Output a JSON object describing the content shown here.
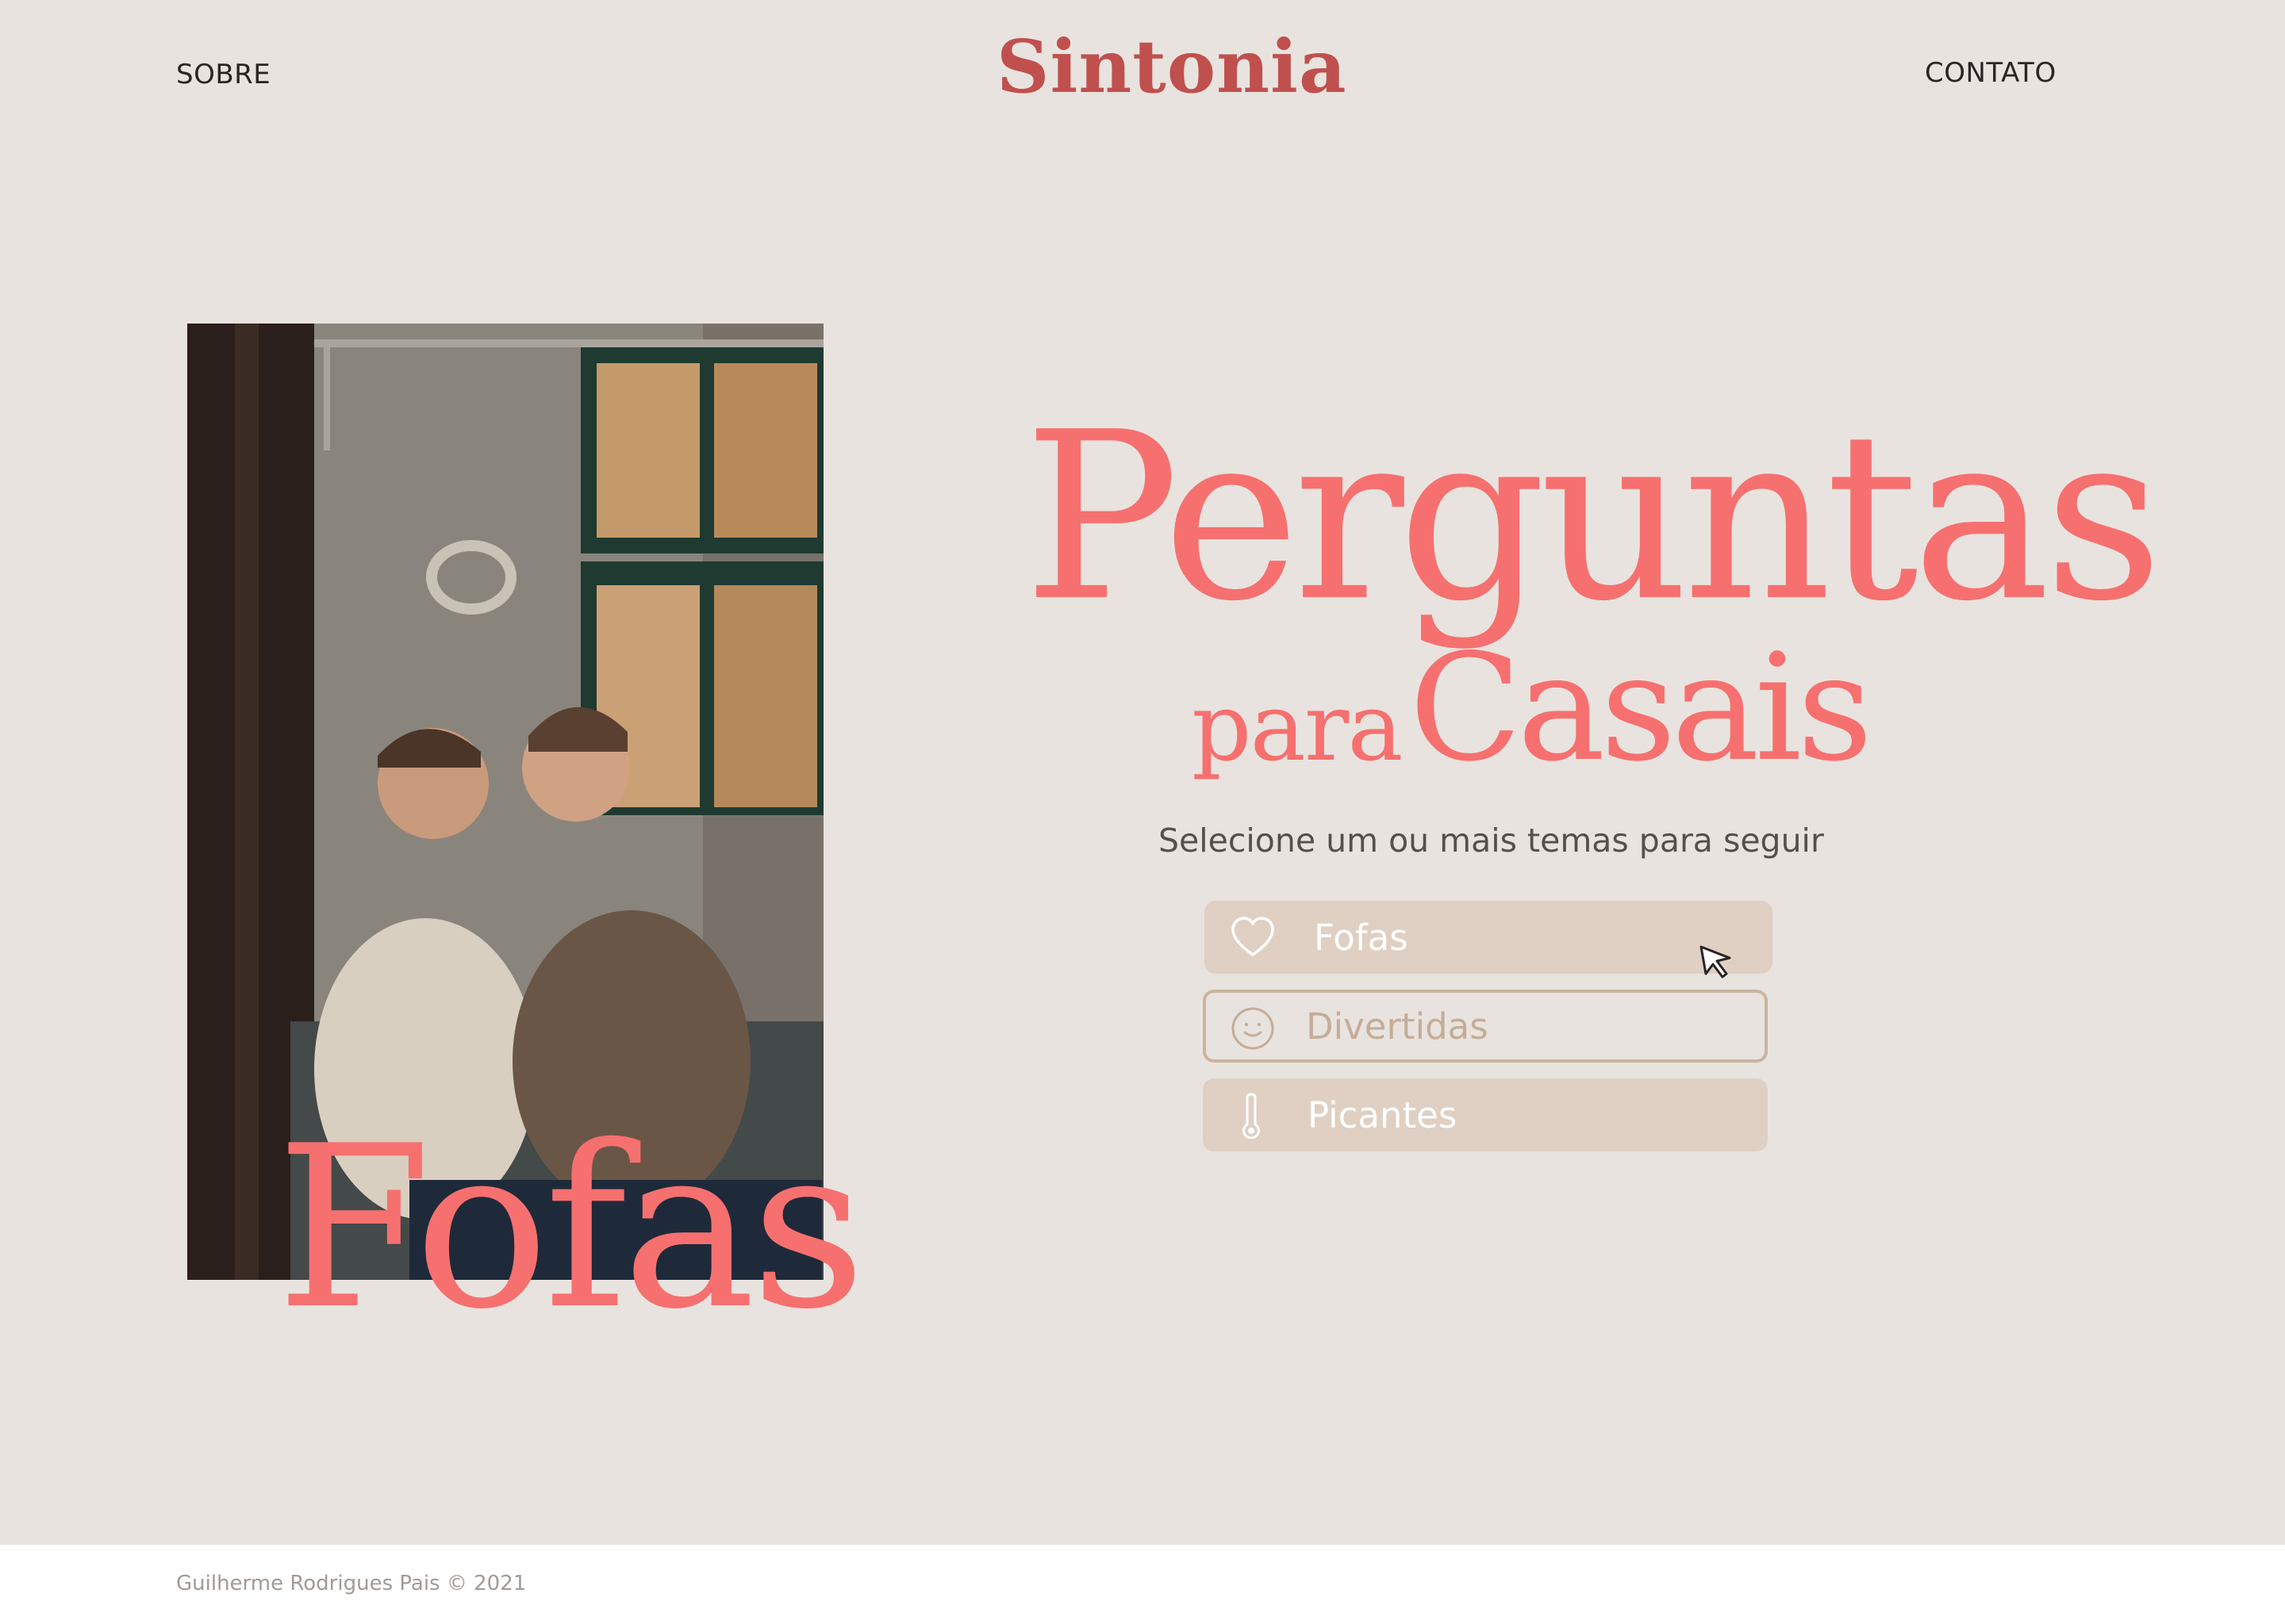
{
  "header": {
    "brand": "Sintonia",
    "nav_left": "SOBRE",
    "nav_right": "CONTATO"
  },
  "hero": {
    "photo_caption": "Fofas",
    "headline_line1": "Perguntas",
    "headline_small": "para",
    "headline_line2": "Casais",
    "subtitle": "Selecione um ou mais temas para seguir"
  },
  "themes": [
    {
      "label": "Fofas",
      "icon": "heart-icon",
      "state": "hover"
    },
    {
      "label": "Divertidas",
      "icon": "smile-icon",
      "state": "outlined"
    },
    {
      "label": "Picantes",
      "icon": "thermometer-icon",
      "state": "filled"
    }
  ],
  "footer": {
    "credit": "Guilherme Rodrigues Pais © 2021"
  },
  "colors": {
    "background": "#e9e3df",
    "brand": "#c0504d",
    "accent": "#f6706f",
    "button_fill": "#dfd0c3",
    "button_outline": "#cbb49e"
  }
}
